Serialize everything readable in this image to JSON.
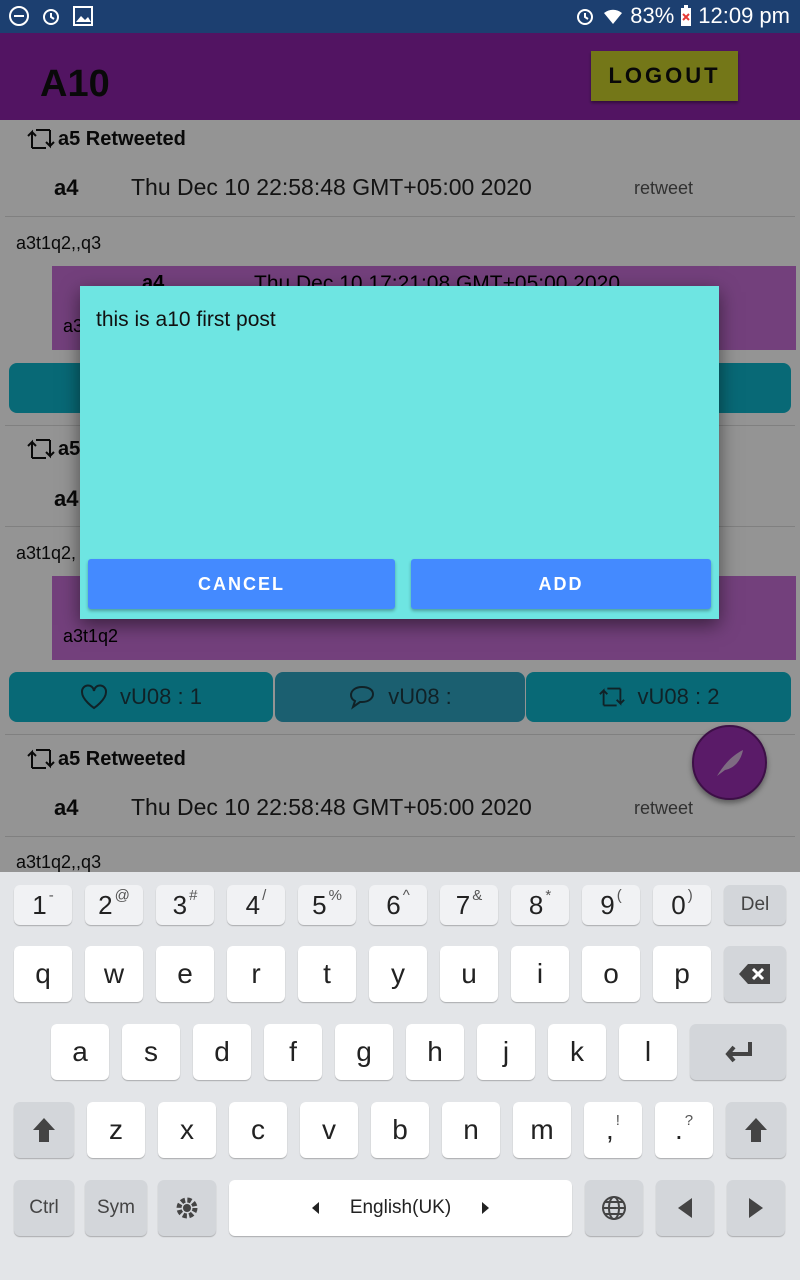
{
  "status_bar": {
    "battery": "83%",
    "time": "12:09 pm"
  },
  "app_bar": {
    "title": "A10",
    "logout_label": "LOGOUT"
  },
  "feed": {
    "posts": [
      {
        "retweeted_by": "a5 Retweeted",
        "author": "a4",
        "date": "Thu Dec 10 22:58:48 GMT+05:00 2020",
        "type": "retweet",
        "body": "a3t1q2,,q3",
        "quoted_author": "a4",
        "quoted_date": "Thu Dec 10 17:21:08 GMT+05:00 2020",
        "quoted_body": "a3"
      },
      {
        "retweeted_by": "a5",
        "author": "a4",
        "body": "a3t1q2,",
        "quoted_body": "a3t1q2",
        "like_label": "vU08 : 1",
        "comment_label": "vU08 :",
        "retweet_label": "vU08 : 2"
      },
      {
        "retweeted_by": "a5 Retweeted",
        "author": "a4",
        "date": "Thu Dec 10 22:58:48 GMT+05:00 2020",
        "type": "retweet",
        "body": "a3t1q2,,q3"
      }
    ]
  },
  "dialog": {
    "input_value": "this is a10 first post",
    "cancel_label": "CANCEL",
    "add_label": "ADD"
  },
  "keyboard": {
    "number_row": [
      {
        "main": "1",
        "alt": "-"
      },
      {
        "main": "2",
        "alt": "@"
      },
      {
        "main": "3",
        "alt": "#"
      },
      {
        "main": "4",
        "alt": "/"
      },
      {
        "main": "5",
        "alt": "%"
      },
      {
        "main": "6",
        "alt": "^"
      },
      {
        "main": "7",
        "alt": "&"
      },
      {
        "main": "8",
        "alt": "*"
      },
      {
        "main": "9",
        "alt": "("
      },
      {
        "main": "0",
        "alt": ")"
      }
    ],
    "del_label": "Del",
    "row1": [
      "q",
      "w",
      "e",
      "r",
      "t",
      "y",
      "u",
      "i",
      "o",
      "p"
    ],
    "row2": [
      "a",
      "s",
      "d",
      "f",
      "g",
      "h",
      "j",
      "k",
      "l"
    ],
    "row3": [
      "z",
      "x",
      "c",
      "v",
      "b",
      "n",
      "m"
    ],
    "comma_key": {
      "main": ",",
      "alt": "!"
    },
    "period_key": {
      "main": ".",
      "alt": "?"
    },
    "ctrl_label": "Ctrl",
    "sym_label": "Sym",
    "space_label": "English(UK)"
  }
}
